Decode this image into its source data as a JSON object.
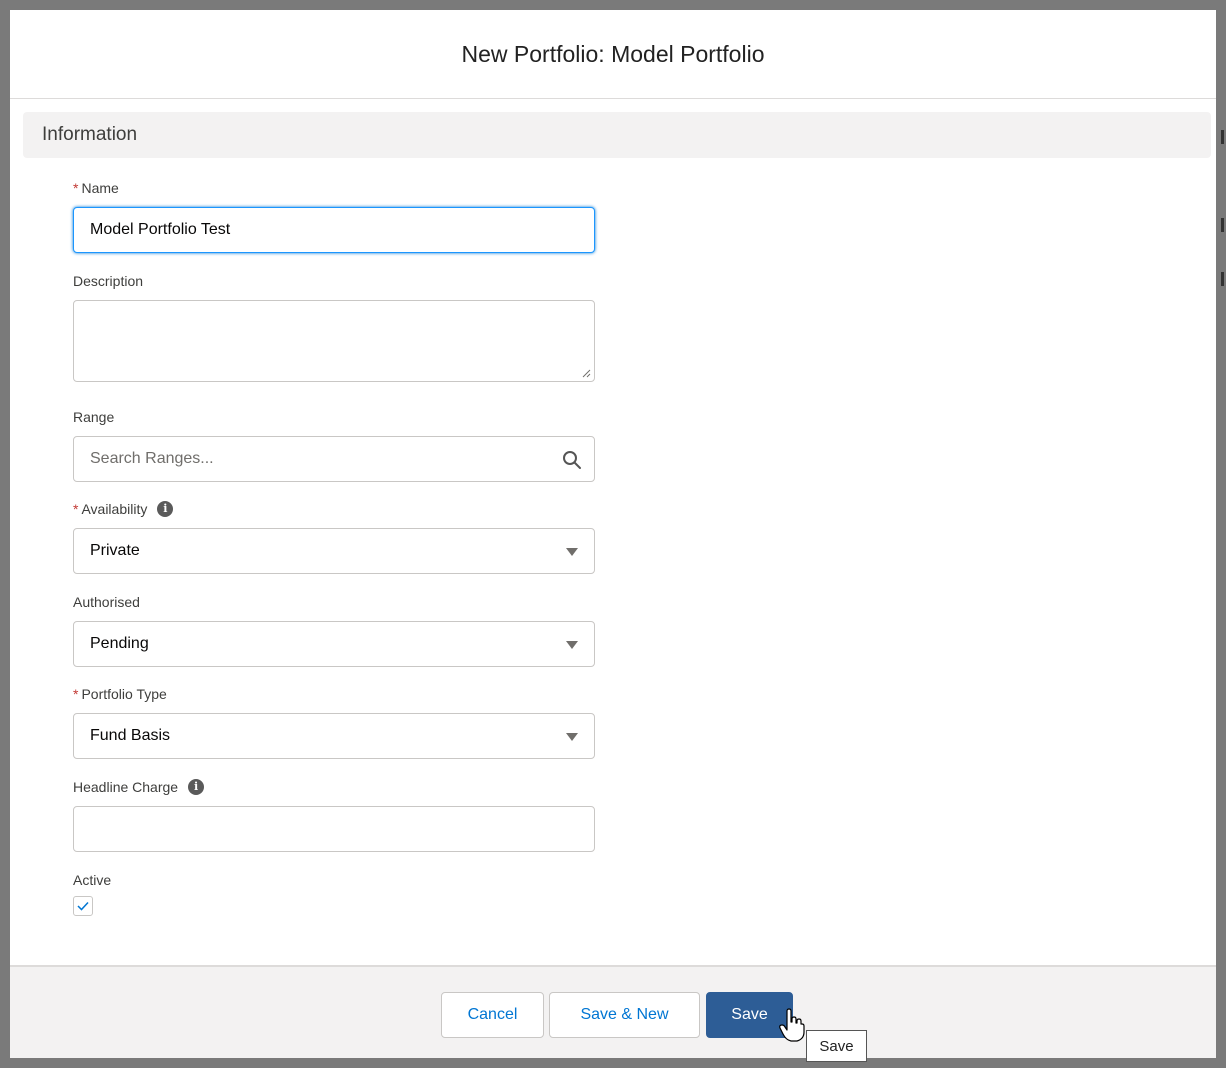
{
  "modal": {
    "title": "New Portfolio: Model Portfolio"
  },
  "section": {
    "title": "Information"
  },
  "fields": {
    "name": {
      "label": "Name",
      "required": "*",
      "value": "Model Portfolio Test"
    },
    "description": {
      "label": "Description",
      "value": ""
    },
    "range": {
      "label": "Range",
      "placeholder": "Search Ranges..."
    },
    "availability": {
      "label": "Availability",
      "required": "*",
      "value": "Private"
    },
    "authorised": {
      "label": "Authorised",
      "value": "Pending"
    },
    "portfolio_type": {
      "label": "Portfolio Type",
      "required": "*",
      "value": "Fund Basis"
    },
    "headline_charge": {
      "label": "Headline Charge",
      "value": ""
    },
    "active": {
      "label": "Active",
      "checked": true
    }
  },
  "info_glyph": "i",
  "footer": {
    "cancel_label": "Cancel",
    "save_new_label": "Save & New",
    "save_label": "Save"
  },
  "tooltip": {
    "text": "Save"
  },
  "colors": {
    "brand": "#2d5d96",
    "focus": "#1b96ff",
    "required": "#c23934",
    "link": "#0176d3"
  },
  "icons": {
    "search": "search-icon",
    "dropdown": "chevron-down-icon",
    "info": "info-icon",
    "check": "check-icon",
    "cursor": "hand-pointer-icon"
  }
}
